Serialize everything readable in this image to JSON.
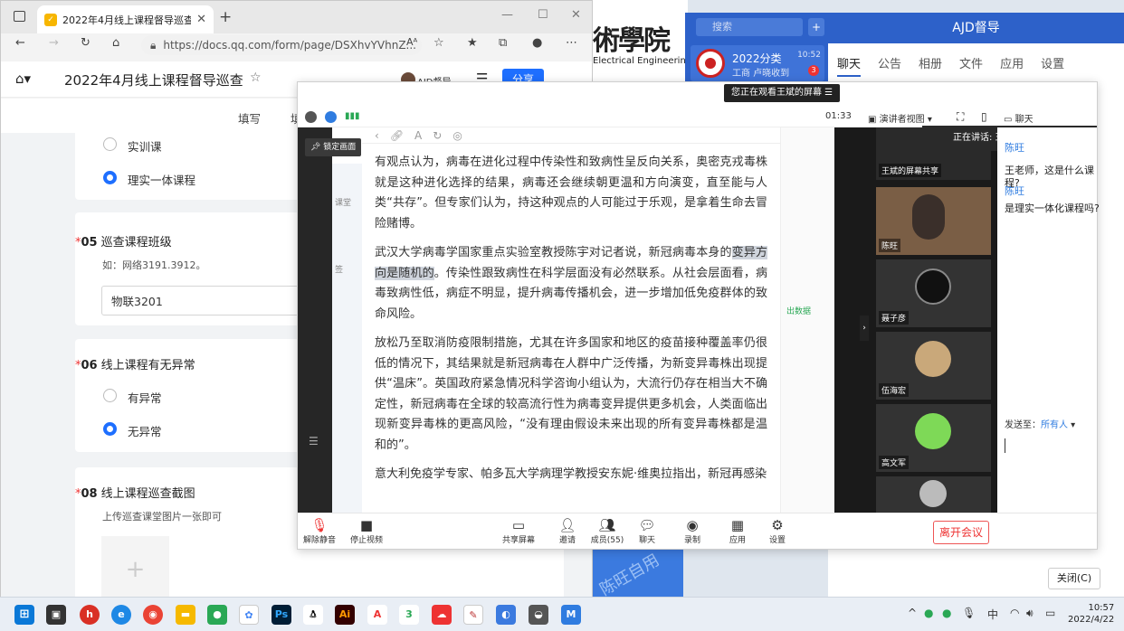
{
  "browser": {
    "tab_title": "2022年4月线上课程督导巡查",
    "url": "https://docs.qq.com/form/page/DSXhvYVhnZ...",
    "read_aloud": "Aᴬ",
    "doc_title": "2022年4月线上课程督导巡查",
    "user_name": "AJD督导",
    "share_label": "分享",
    "subtab_fill": "填写",
    "subtab_partial": "填"
  },
  "form": {
    "q4_options": [
      "实训课",
      "理实一体课程"
    ],
    "q4_selected": 1,
    "q5": {
      "num": "05",
      "title": "巡查课程班级",
      "hint": "如：网络3191.3912。",
      "value": "物联3201"
    },
    "q6": {
      "num": "06",
      "title": "线上课程有无异常",
      "options": [
        "有异常",
        "无异常"
      ],
      "selected": 1
    },
    "q8": {
      "num": "08",
      "title": "线上课程巡查截图",
      "hint": "上传巡查课堂图片一张即可",
      "upload_icon": "+"
    }
  },
  "school": {
    "name_cn": "術學院",
    "name_en": "Electrical Engineering"
  },
  "wework": {
    "search_placeholder": "搜索",
    "conv_title": "2022分类",
    "conv_sub": "工商 卢晓收到",
    "conv_time": "10:52",
    "conv_badge": "3",
    "window_title": "AJD督导",
    "tabs": [
      "聊天",
      "公告",
      "相册",
      "文件",
      "应用",
      "设置"
    ],
    "close_button": "关闭(C)"
  },
  "meeting": {
    "viewing_banner": "您正在观看王斌的屏幕",
    "timer": "01:33",
    "view_mode": "演讲者视图",
    "chat_label": "聊天",
    "lock_tip": "锁定画面",
    "sidebar_text": [
      "课堂",
      "签",
      "出数据"
    ],
    "article": [
      "有观点认为，病毒在进化过程中传染性和致病性呈反向关系，奥密克戎毒株就是这种进化选择的结果，病毒还会继续朝更温和方向演变，直至能与人类“共存”。但专家们认为，持这种观点的人可能过于乐观，是拿着生命去冒险赌博。",
      "武汉大学病毒学国家重点实验室教授陈宇对记者说，新冠病毒本身的",
      "变异方向是随机的",
      "。传染性跟致病性在科学层面没有必然联系。从社会层面看，病毒致病性低，病症不明显，提升病毒传播机会，进一步增加低免疫群体的致命风险。",
      "放松乃至取消防疫限制措施，尤其在许多国家和地区的疫苗接种覆盖率仍很低的情况下，其结果就是新冠病毒在人群中广泛传播，为新变异毒株出现提供“温床”。英国政府紧急情况科学咨询小组认为，大流行仍存在相当大不确定性，新冠病毒在全球的较高流行性为病毒变异提供更多机会，人类面临出现新变异毒株的更高风险，“没有理由假设未来出现的所有变异毒株都是温和的”。",
      "意大利免疫学专家、帕多瓦大学病理学教授安东妮·维奥拉指出，新冠再感染"
    ],
    "speaking": "正在讲话: 王斌",
    "tiles": [
      {
        "name": "王斌的屏幕共享"
      },
      {
        "name": "陈旺"
      },
      {
        "name": "聂子彦"
      },
      {
        "name": "伍海宏"
      },
      {
        "name": "高文军"
      },
      {
        "name": ""
      }
    ],
    "chat": [
      {
        "name": "陈旺",
        "msg": ""
      },
      {
        "name": "",
        "msg": "王老师，这是什么课程?"
      },
      {
        "name": "陈旺",
        "msg": ""
      },
      {
        "name": "",
        "msg": "是理实一体化课程吗?"
      }
    ],
    "send_to_label": "发送至：",
    "send_to_value": "所有人",
    "toolbar": [
      {
        "label": "解除静音",
        "icon": "mic-icon"
      },
      {
        "label": "停止视频",
        "icon": "camera-icon"
      },
      {
        "label": "共享屏幕",
        "icon": "screen-share-icon"
      },
      {
        "label": "邀请",
        "icon": "invite-icon"
      },
      {
        "label": "成员(55)",
        "icon": "members-icon"
      },
      {
        "label": "聊天",
        "icon": "chat-icon"
      },
      {
        "label": "录制",
        "icon": "record-icon"
      },
      {
        "label": "应用",
        "icon": "apps-icon"
      },
      {
        "label": "设置",
        "icon": "settings-icon"
      }
    ],
    "leave_button": "离开会议"
  },
  "watermark": "陈旺自用",
  "taskbar": {
    "apps": [
      "edge",
      "chrome",
      "files",
      "wechat",
      "ps",
      "qq",
      "ai",
      "acrobat",
      "num3",
      "baidu",
      "paint",
      "tencent",
      "meeting"
    ],
    "ime": "中",
    "time": "10:57",
    "date": "2022/4/22"
  },
  "colors": {
    "accent": "#1e6fff",
    "wework_blue": "#2d61c9",
    "leave_red": "#e33333"
  }
}
